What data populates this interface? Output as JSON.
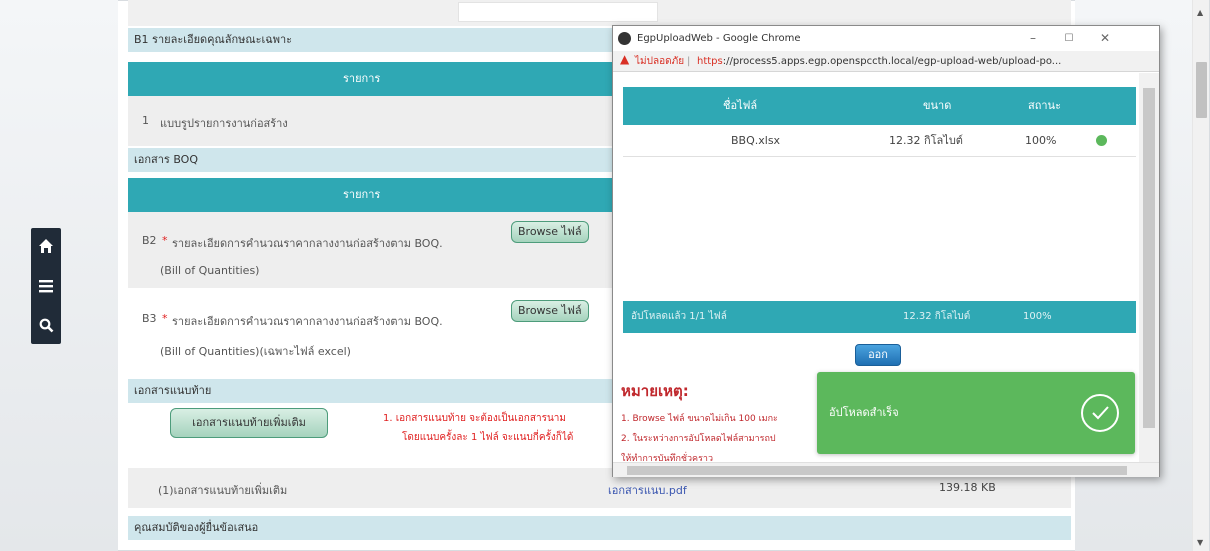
{
  "nav": {
    "home_icon": "home-icon",
    "menu_icon": "menu-icon",
    "search_icon": "search-icon"
  },
  "section_b1": {
    "title": "B1 รายละเอียดคุณลักษณะเฉพาะ",
    "column_header": "รายการ",
    "row1_number": "1",
    "row1_text": "แบบรูปรายการงานก่อสร้าง"
  },
  "section_boq": {
    "title": "เอกสาร BOQ",
    "column_header": "รายการ",
    "b2_code": "B2",
    "b2_text": "รายละเอียดการคำนวณราคากลางงานก่อสร้างตาม BOQ.",
    "b2_subtext": "(Bill of Quantities)",
    "b3_code": "B3",
    "b3_text": "รายละเอียดการคำนวณราคากลางงานก่อสร้างตาม BOQ.",
    "b3_subtext": "(Bill of Quantities)(เฉพาะไฟล์ excel)",
    "required_mark": "*",
    "browse_label": "Browse ไฟล์"
  },
  "section_attach": {
    "title": "เอกสารแนบท้าย",
    "add_button": "เอกสารแนบท้ายเพิ่มเติม",
    "note_line1": "1. เอกสารแนบท้าย จะต้องเป็นเอกสารนาม",
    "note_line2": "โดยแนบครั้งละ 1 ไฟล์ จะแนบกี่ครั้งก็ได้",
    "row_label": "(1)เอกสารแนบท้ายเพิ่มเติม",
    "row_file": "เอกสารแนบ.pdf",
    "row_size": "139.18 KB"
  },
  "section_bidder": {
    "title": "คุณสมบัติของผู้ยื่นข้อเสนอ"
  },
  "popup": {
    "window_title": "EgpUploadWeb - Google Chrome",
    "insecure_label": "ไม่ปลอดภัย",
    "url_scheme": "https",
    "url_rest": "://process5.apps.egp.openspccth.local/egp-upload-web/upload-po...",
    "table_headers": [
      "ชื่อไฟล์",
      "ขนาด",
      "สถานะ"
    ],
    "file_row": {
      "name": "BBQ.xlsx",
      "size": "12.32 กิโลไบต์",
      "status": "100%"
    },
    "total_row": {
      "label": "อัปโหลดแล้ว 1/1 ไฟล์",
      "size": "12.32 กิโลไบต์",
      "status": "100%"
    },
    "close_button": "ออก",
    "note_title": "หมายเหตุ:",
    "note_line1": "1. Browse ไฟล์ ขนาดไม่เกิน 100 เมกะ",
    "note_line2": "2. ในระหว่างการอัปโหลดไฟล์สามารถป",
    "note_line3": "ให้ทำการบันทึกชั่วคราว",
    "toast_message": "อัปโหลดสำเร็จ"
  },
  "colors": {
    "teal_header": "#2fa8b4",
    "section_band": "#cfe6ec",
    "toast_green": "#5cb85c",
    "required_red": "#e02020"
  }
}
